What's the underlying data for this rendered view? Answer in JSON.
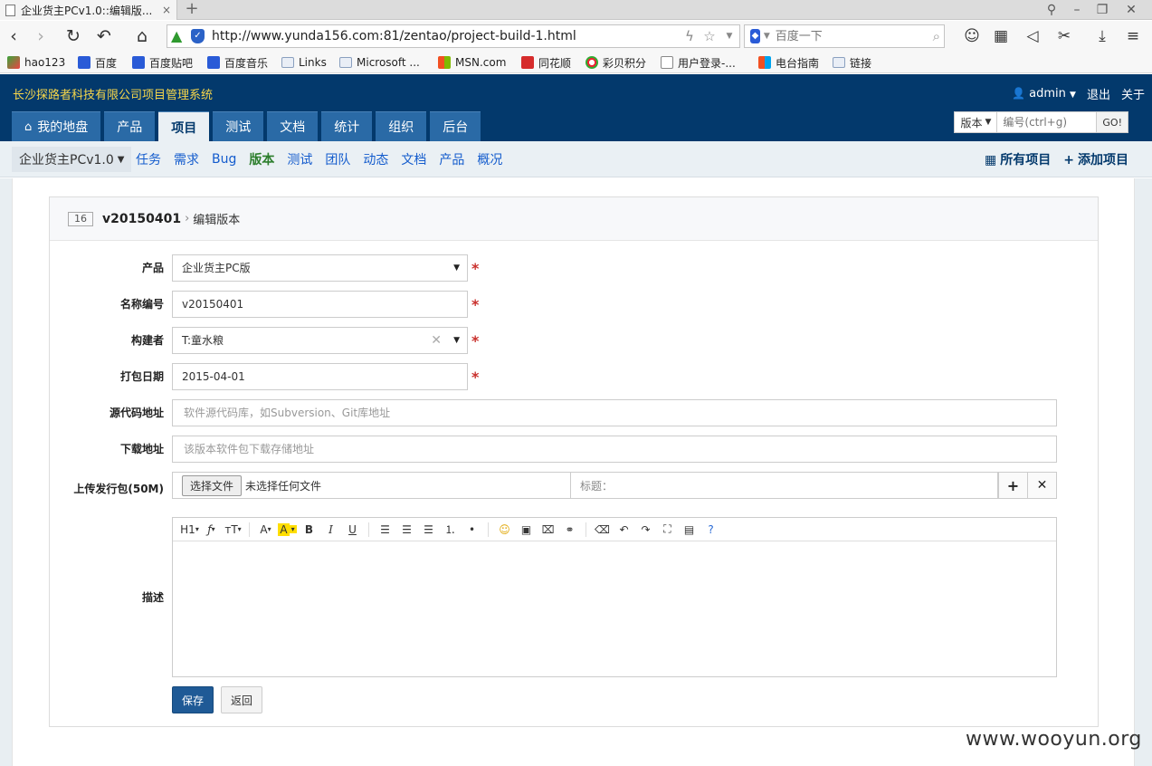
{
  "browser": {
    "tab_title": "企业货主PCv1.0::编辑版...",
    "tab_close": "×",
    "new_tab": "+",
    "url": "http://www.yunda156.com:81/zentao/project-build-1.html",
    "search_placeholder": "百度一下",
    "bookmarks": [
      "hao123",
      "百度",
      "百度贴吧",
      "百度音乐",
      "Links",
      "Microsoft ...",
      "MSN.com",
      "同花顺",
      "彩贝积分",
      "用户登录-...",
      "电台指南",
      "链接"
    ]
  },
  "app": {
    "system_name": "长沙探路者科技有限公司项目管理系统",
    "user": "admin",
    "logout": "退出",
    "about": "关于",
    "main_tabs": [
      "我的地盘",
      "产品",
      "项目",
      "测试",
      "文档",
      "统计",
      "组织",
      "后台"
    ],
    "search_type": "版本",
    "search_placeholder": "编号(ctrl+g)",
    "search_go": "GO!",
    "project_select": "企业货主PCv1.0",
    "sub_nav": [
      "任务",
      "需求",
      "Bug",
      "版本",
      "测试",
      "团队",
      "动态",
      "文档",
      "产品",
      "概况"
    ],
    "all_projects": "所有项目",
    "add_project": "添加项目"
  },
  "panel": {
    "id": "16",
    "title": "v20150401",
    "action": "编辑版本"
  },
  "form": {
    "product_label": "产品",
    "product_value": "企业货主PC版",
    "name_label": "名称编号",
    "name_value": "v20150401",
    "builder_label": "构建者",
    "builder_value": "T:童水粮",
    "date_label": "打包日期",
    "date_value": "2015-04-01",
    "scm_label": "源代码地址",
    "scm_placeholder": "软件源代码库，如Subversion、Git库地址",
    "download_label": "下载地址",
    "download_placeholder": "该版本软件包下载存储地址",
    "upload_label": "上传发行包(50M)",
    "file_button": "选择文件",
    "file_status": "未选择任何文件",
    "title_label": "标题：",
    "desc_label": "描述",
    "required_mark": "*",
    "save": "保存",
    "back": "返回"
  },
  "editor_toolbar": [
    "H1",
    "ƒ",
    "тT",
    "A",
    "A",
    "B",
    "I",
    "U"
  ],
  "watermark": "www.wooyun.org"
}
